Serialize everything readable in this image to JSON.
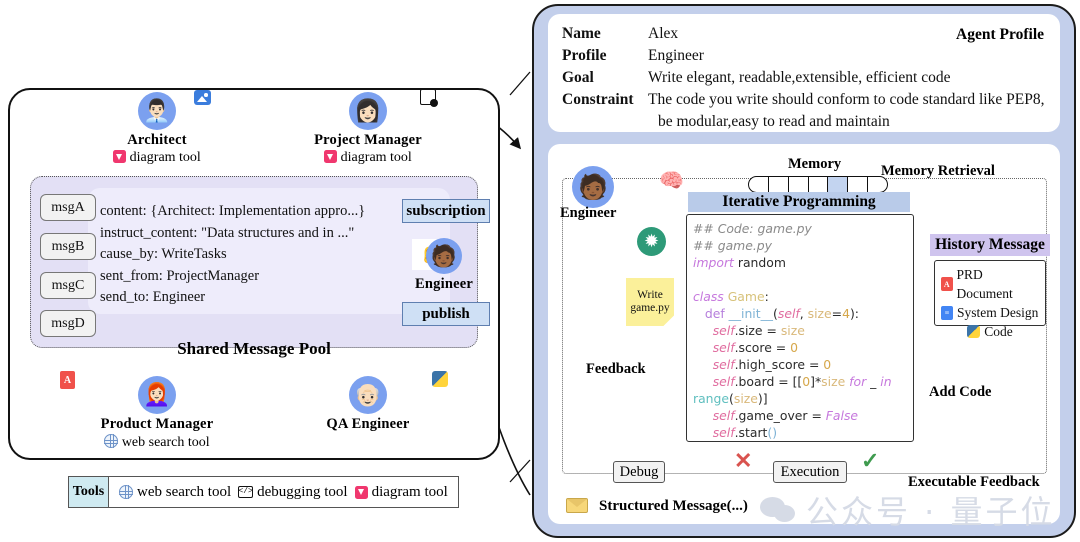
{
  "left_panel": {
    "roles": [
      {
        "name": "Architect",
        "tool": "diagram tool",
        "tool_icon": "diagram-tool-icon"
      },
      {
        "name": "Project Manager",
        "tool": "diagram tool",
        "tool_icon": "diagram-tool-icon"
      },
      {
        "name": "Product Manager",
        "tool": "web search tool",
        "tool_icon": "web-search-tool-icon"
      },
      {
        "name": "QA Engineer",
        "tool": "",
        "tool_icon": ""
      }
    ],
    "engineer_label": "Engineer",
    "message_boxes": [
      "msgA",
      "msgB",
      "msgC",
      "msgD"
    ],
    "message_fields": [
      "content: {Architect: Implementation appro...}",
      "instruct_content: \"Data structures and in ...\"",
      "cause_by: WriteTasks",
      "sent_from: ProjectManager",
      "send_to: Engineer"
    ],
    "pool_title": "Shared Message Pool",
    "subscription_label": "subscription",
    "publish_label": "publish",
    "listen_icon": "ear-listen-icon",
    "artifact_icons": [
      "image-artifact-icon",
      "report-artifact-icon",
      "pdf-artifact-icon",
      "python-artifact-icon"
    ],
    "tools": {
      "label": "Tools",
      "items": [
        {
          "name": "web search tool",
          "icon": "web-search-tool-icon"
        },
        {
          "name": "debugging tool",
          "icon": "debugging-tool-icon"
        },
        {
          "name": "diagram tool",
          "icon": "diagram-tool-icon"
        }
      ]
    }
  },
  "right_panel": {
    "profile": {
      "title": "Agent Profile",
      "rows": [
        {
          "key": "Name",
          "value": "Alex"
        },
        {
          "key": "Profile",
          "value": "Engineer"
        },
        {
          "key": "Goal",
          "value": "Write elegant, readable,extensible, efficient code"
        },
        {
          "key": "Constraint",
          "value": "The code you write should conform to code standard like PEP8,"
        },
        {
          "key": "",
          "value": "be modular,easy to read and maintain"
        }
      ]
    },
    "engineer_label": "Engineer",
    "brain_icon": "brain-icon",
    "memory_label": "Memory",
    "memory_retrieval_label": "Memory Retrieval",
    "memory_segments": 7,
    "memory_active_index": 4,
    "iterative_programming_label": "Iterative Programming",
    "gpt_icon": "openai-logo-icon",
    "write_note": "Write\ngame.py",
    "feedback_label": "Feedback",
    "add_code_label": "Add Code",
    "history_message_label": "History Message",
    "history_items": [
      {
        "label": "PRD Document",
        "icon": "pdf-file-icon"
      },
      {
        "label": "System Design",
        "icon": "doc-file-icon"
      },
      {
        "label": "Code",
        "icon": "python-file-icon"
      }
    ],
    "debug_label": "Debug",
    "execution_label": "Execution",
    "executable_feedback_label": "Executable Feedback",
    "fail_mark": "✕",
    "pass_mark": "✓",
    "structured_message_label": "Structured Message(...)",
    "structured_message_icon": "envelope-icon",
    "code": [
      [
        {
          "t": "## Code: game.py",
          "c": "c-com"
        }
      ],
      [
        {
          "t": "## game.py",
          "c": "c-com"
        }
      ],
      [
        {
          "t": "import ",
          "c": "c-kw"
        },
        {
          "t": "random",
          "c": "c-plain"
        }
      ],
      [
        {
          "t": " ",
          "c": "c-plain"
        }
      ],
      [
        {
          "t": "class ",
          "c": "c-kw"
        },
        {
          "t": "Game",
          "c": "c-cls"
        },
        {
          "t": ":",
          "c": "c-plain"
        }
      ],
      [
        {
          "t": "   def ",
          "c": "c-kw2"
        },
        {
          "t": "__init__",
          "c": "c-fn"
        },
        {
          "t": "(",
          "c": "c-plain"
        },
        {
          "t": "self",
          "c": "c-self"
        },
        {
          "t": ", ",
          "c": "c-plain"
        },
        {
          "t": "size",
          "c": "c-arg"
        },
        {
          "t": "=",
          "c": "c-plain"
        },
        {
          "t": "4",
          "c": "c-num"
        },
        {
          "t": "):",
          "c": "c-plain"
        }
      ],
      [
        {
          "t": "     ",
          "c": "c-plain"
        },
        {
          "t": "self",
          "c": "c-self"
        },
        {
          "t": ".size = ",
          "c": "c-plain"
        },
        {
          "t": "size",
          "c": "c-arg"
        }
      ],
      [
        {
          "t": "     ",
          "c": "c-plain"
        },
        {
          "t": "self",
          "c": "c-self"
        },
        {
          "t": ".score = ",
          "c": "c-plain"
        },
        {
          "t": "0",
          "c": "c-num"
        }
      ],
      [
        {
          "t": "     ",
          "c": "c-plain"
        },
        {
          "t": "self",
          "c": "c-self"
        },
        {
          "t": ".high_score = ",
          "c": "c-plain"
        },
        {
          "t": "0",
          "c": "c-num"
        }
      ],
      [
        {
          "t": "     ",
          "c": "c-plain"
        },
        {
          "t": "self",
          "c": "c-self"
        },
        {
          "t": ".board = [[",
          "c": "c-plain"
        },
        {
          "t": "0",
          "c": "c-num"
        },
        {
          "t": "]*",
          "c": "c-plain"
        },
        {
          "t": "size",
          "c": "c-arg"
        },
        {
          "t": " for ",
          "c": "c-kw"
        },
        {
          "t": "_ ",
          "c": "c-plain"
        },
        {
          "t": "in",
          "c": "c-kw"
        }
      ],
      [
        {
          "t": "range",
          "c": "c-range"
        },
        {
          "t": "(",
          "c": "c-plain"
        },
        {
          "t": "size",
          "c": "c-arg"
        },
        {
          "t": ")]",
          "c": "c-plain"
        }
      ],
      [
        {
          "t": "     ",
          "c": "c-plain"
        },
        {
          "t": "self",
          "c": "c-self"
        },
        {
          "t": ".game_over = ",
          "c": "c-plain"
        },
        {
          "t": "False",
          "c": "c-kw"
        }
      ],
      [
        {
          "t": "     ",
          "c": "c-plain"
        },
        {
          "t": "self",
          "c": "c-self"
        },
        {
          "t": ".start",
          "c": "c-plain"
        },
        {
          "t": "()",
          "c": "c-fn"
        }
      ]
    ]
  },
  "watermark": {
    "text": "公众号 · 量子位",
    "logo": "wechat-logo-icon"
  },
  "colors": {
    "avatar_blue": "#7ba0ef",
    "panel_border_blue": "#c3cfeb",
    "pool_purple": "#e3e0f5",
    "tag_blue": "#cfe0f5",
    "band_blue": "#b9cbe9",
    "history_purple": "#cfc4ee",
    "note_yellow": "#fbf09a",
    "gpt_green": "#2e9a78",
    "fail_red": "#d9534f",
    "pass_green": "#3f9b4f",
    "tools_cyan": "#cfeaf1"
  }
}
